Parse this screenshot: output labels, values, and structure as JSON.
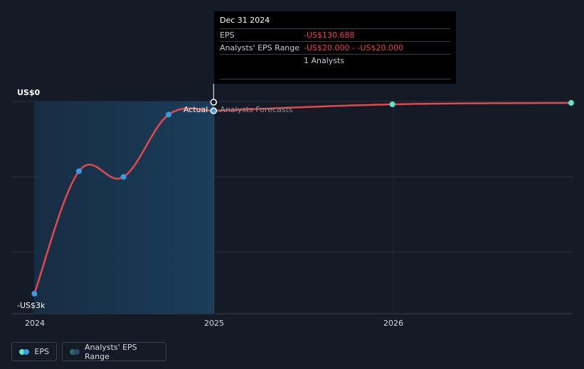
{
  "chart_data": {
    "type": "line",
    "title": "",
    "xlabel": "",
    "ylabel": "",
    "y_axis_labels": {
      "top": "US$0",
      "bottom": "-US$3k"
    },
    "x_ticks": [
      "2024",
      "2025",
      "2026"
    ],
    "ylim": [
      -3000,
      0
    ],
    "series": [
      {
        "name": "EPS",
        "kind": "actual",
        "color": "#e5484d",
        "points": [
          {
            "x": "2023-12-31",
            "y": -2700
          },
          {
            "x": "2024-03-31",
            "y": -980
          },
          {
            "x": "2024-06-30",
            "y": -1060
          },
          {
            "x": "2024-09-30",
            "y": -185
          },
          {
            "x": "2024-12-31",
            "y": -130.688
          }
        ]
      },
      {
        "name": "Analysts' EPS Range",
        "kind": "forecast",
        "color": "#e5484d",
        "points": [
          {
            "x": "2024-12-31",
            "y": -130.688
          },
          {
            "x": "2025-12-31",
            "y": -40
          },
          {
            "x": "2026-12-31",
            "y": -20
          }
        ]
      }
    ],
    "divider_labels": {
      "left": "Actual",
      "right": "Analysts Forecasts"
    },
    "colors": {
      "actual_dot": "#3b9ae1",
      "forecast_dot": "#5fe3c8",
      "line": "#e5484d",
      "shade": "#1a3a55"
    }
  },
  "tooltip": {
    "date": "Dec 31 2024",
    "rows": [
      {
        "label": "EPS",
        "value": "-US$130.688"
      },
      {
        "label": "Analysts' EPS Range",
        "value": "-US$20.000 - -US$20.000"
      },
      {
        "label": "",
        "value": "1 Analysts"
      }
    ]
  },
  "legend": [
    {
      "label": "EPS",
      "colors": [
        "#5fe3c8",
        "#3b9ae1"
      ]
    },
    {
      "label": "Analysts' EPS Range",
      "colors": [
        "#2f6a6a",
        "#2a4a66"
      ]
    }
  ]
}
